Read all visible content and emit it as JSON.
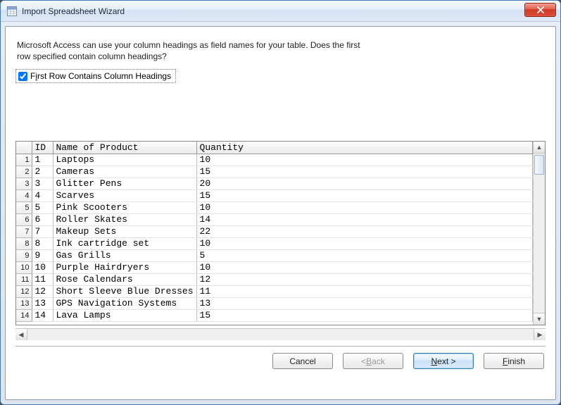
{
  "window": {
    "title": "Import Spreadsheet Wizard"
  },
  "intro": {
    "line1": "Microsoft Access can use your column headings as field names for your table. Does the first",
    "line2": "row specified contain column headings?"
  },
  "checkbox": {
    "label_pre": "F",
    "label_ul": "i",
    "label_post": "rst Row Contains Column Headings",
    "checked": true
  },
  "grid": {
    "headers": {
      "id": "ID",
      "name": "Name of Product",
      "qty": "Quantity"
    },
    "rows": [
      {
        "n": "1",
        "id": "1",
        "name": "Laptops",
        "qty": "10"
      },
      {
        "n": "2",
        "id": "2",
        "name": "Cameras",
        "qty": "15"
      },
      {
        "n": "3",
        "id": "3",
        "name": "Glitter Pens",
        "qty": "20"
      },
      {
        "n": "4",
        "id": "4",
        "name": "Scarves",
        "qty": "15"
      },
      {
        "n": "5",
        "id": "5",
        "name": "Pink Scooters",
        "qty": "10"
      },
      {
        "n": "6",
        "id": "6",
        "name": "Roller Skates",
        "qty": "14"
      },
      {
        "n": "7",
        "id": "7",
        "name": "Makeup Sets",
        "qty": "22"
      },
      {
        "n": "8",
        "id": "8",
        "name": "Ink cartridge set",
        "qty": "10"
      },
      {
        "n": "9",
        "id": "9",
        "name": "Gas Grills",
        "qty": "5"
      },
      {
        "n": "10",
        "id": "10",
        "name": "Purple Hairdryers",
        "qty": "10"
      },
      {
        "n": "11",
        "id": "11",
        "name": "Rose Calendars",
        "qty": "12"
      },
      {
        "n": "12",
        "id": "12",
        "name": "Short Sleeve Blue Dresses",
        "qty": "11"
      },
      {
        "n": "13",
        "id": "13",
        "name": "GPS Navigation Systems",
        "qty": "13"
      },
      {
        "n": "14",
        "id": "14",
        "name": "Lava Lamps",
        "qty": "15"
      }
    ]
  },
  "buttons": {
    "cancel": "Cancel",
    "back_lt": "< ",
    "back_ul": "B",
    "back_post": "ack",
    "next_ul": "N",
    "next_post": "ext >",
    "finish_ul": "F",
    "finish_post": "inish"
  }
}
